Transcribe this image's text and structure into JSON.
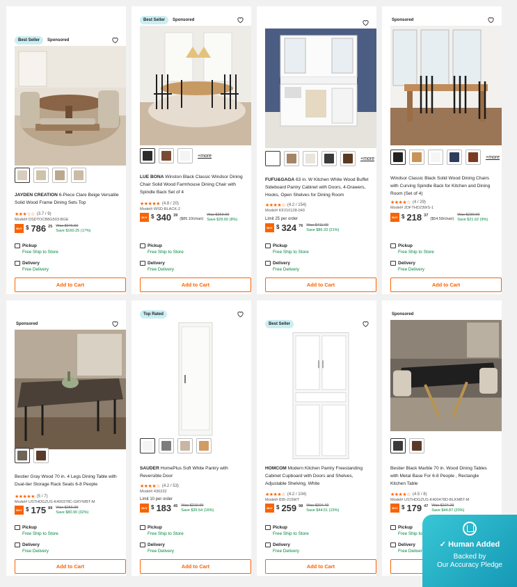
{
  "products": [
    {
      "badges": [
        "Best Seller",
        "Sponsored"
      ],
      "brand": "JAYDEN CREATION",
      "title": "6-Piece Clare Beige Versatile Solid Wood Frame Dining Sets Top",
      "stars": "★★★☆☆",
      "rating": "(3.7 / 9)",
      "model": "Model# DSDTOCB8G503-BGE",
      "limit": "",
      "price_dollars": "786",
      "price_cents": "25",
      "price_unit": "",
      "was": "Was $946.50",
      "save": "Save $160.25 (17%)",
      "swatch_colors": [
        "#d8cdbd",
        "#cfc2ab",
        "#bca88c",
        "#c9bba5"
      ],
      "more": "",
      "pickup": "Pickup",
      "pickup_sub": "Free Ship to Store",
      "delivery": "Delivery",
      "delivery_sub": "Free Delivery",
      "cta": "Add to Cart"
    },
    {
      "badges": [
        "Best Seller",
        "Sponsored"
      ],
      "brand": "LUE BONA",
      "title": "Winston Black Classic Windsor Dining Chair Solid Wood Farmhouse Dining Chair with Spindle Back Set of 4",
      "stars": "★★★★★",
      "rating": "(4.8 / 20)",
      "model": "Model# WSD-BLACK-2",
      "limit": "",
      "price_dollars": "340",
      "price_cents": "39",
      "price_unit": "($85.10/chair)",
      "was": "Was $369.99",
      "save": "Save $29.60 (8%)",
      "swatch_colors": [
        "#2b2b2b",
        "#7a4b32",
        "#f4f4f4"
      ],
      "more": "+more",
      "pickup": "Pickup",
      "pickup_sub": "Free Ship to Store",
      "delivery": "Delivery",
      "delivery_sub": "Free Delivery",
      "cta": "Add to Cart"
    },
    {
      "badges": [],
      "brand": "FUFU&GAGA",
      "title": "63 in. W Kitchen White Wood Buffet Sideboard Pantry Cabinet with Doors, 4-Drawers, Hooks, Open Shelves for Dining Room",
      "stars": "★★★★☆",
      "rating": "(4.2 / 154)",
      "model": "Model# KF210128-043",
      "limit": "Limit 25 per order",
      "price_dollars": "324",
      "price_cents": "76",
      "price_unit": "",
      "was": "Was $411.09",
      "save": "Save $86.33 (21%)",
      "swatch_colors": [
        "#ffffff",
        "#a68466",
        "#e9e4dc",
        "#3a3a3a",
        "#5a3b22"
      ],
      "more": "+more",
      "pickup": "Pickup",
      "pickup_sub": "Free Ship to Store",
      "delivery": "Delivery",
      "delivery_sub": "Free Delivery",
      "cta": "Add to Cart"
    },
    {
      "badges": [
        "Sponsored"
      ],
      "brand": "",
      "title": "Windsor Classic Black Solid Wood Dining Chairs with Curving Spindle Back for Kitchen and Dining Room (Set of 4)",
      "stars": "★★★★☆",
      "rating": "(4 / 29)",
      "model": "Model# 2DFTHD23WS-1",
      "limit": "",
      "price_dollars": "218",
      "price_cents": "37",
      "price_unit": "($54.59/chair)",
      "was": "Was $239.99",
      "save": "Save $21.62 (9%)",
      "swatch_colors": [
        "#222222",
        "#c89457",
        "#f6f6f6",
        "#2e3d5c",
        "#7b3a22"
      ],
      "more": "+more",
      "pickup": "Pickup",
      "pickup_sub": "Free Ship to Store",
      "delivery": "Delivery",
      "delivery_sub": "Free Delivery",
      "cta": "Add to Cart"
    },
    {
      "badges": [
        "Sponsored"
      ],
      "brand": "",
      "title": "Bestier Gray Wood 70 in. 4 Legs Dining Table with Dual-tier Storage Rack Seats 6-8 People",
      "stars": "★★★★★",
      "rating": "(5 / 7)",
      "model": "Model# USTHDGZUS-K400378C-GRYWBT-M",
      "limit": "",
      "price_dollars": "175",
      "price_cents": "89",
      "price_unit": "",
      "was": "Was $256.99",
      "save": "Save $80.90 (32%)",
      "swatch_colors": [
        "#6e6458",
        "#5a3a2a"
      ],
      "more": "",
      "pickup": "Pickup",
      "pickup_sub": "Free Ship to Store",
      "delivery": "Delivery",
      "delivery_sub": "Free Delivery",
      "cta": "Add to Cart"
    },
    {
      "badges": [
        "Top Rated"
      ],
      "brand": "SAUDER",
      "title": "HomePlus Soft White Pantry with Reversible Door",
      "stars": "★★★★☆",
      "rating": "(4.2 / 53)",
      "model": "Model# 430232",
      "limit": "Limit 10 per order",
      "price_dollars": "183",
      "price_cents": "45",
      "price_unit": "",
      "was": "Was $219.99",
      "save": "Save $35.54 (16%)",
      "swatch_colors": [
        "#f5f5f5",
        "#7d7d7d",
        "#c9b6a2",
        "#d19b62"
      ],
      "more": "",
      "pickup": "Pickup",
      "pickup_sub": "Free Ship to Store",
      "delivery": "Delivery",
      "delivery_sub": "Free Delivery",
      "cta": "Add to Cart"
    },
    {
      "badges": [
        "Best Seller"
      ],
      "brand": "HOMCOM",
      "title": "Modern Kitchen Pantry Freestanding Cabinet Cupboard with Doors and Shelves, Adjustable Shelving, White",
      "stars": "★★★★☆",
      "rating": "(4.2 / 104)",
      "model": "Model# 835-215WT",
      "limit": "",
      "price_dollars": "259",
      "price_cents": "98",
      "price_unit": "",
      "was": "Was $304.49",
      "save": "Save $44.51 (15%)",
      "swatch_colors": [],
      "more": "",
      "pickup": "Pickup",
      "pickup_sub": "Free Ship to Store",
      "delivery": "Delivery",
      "delivery_sub": "Free Delivery",
      "cta": "Add to Cart"
    },
    {
      "badges": [
        "Sponsored"
      ],
      "brand": "",
      "title": "Bestier Black Marble 70 in. Wood Dining Tables with Metal Base For 6-8 People , Rectangle Kitchen Table",
      "stars": "★★★★☆",
      "rating": "(4.5 / 8)",
      "model": "Model# USTHDGZUS-K400478D-BLKMBT-M",
      "limit": "",
      "price_dollars": "179",
      "price_cents": "47",
      "price_unit": "",
      "was": "Was $224.29",
      "save": "Save $44.87 (20%)",
      "swatch_colors": [
        "#3a3a3a",
        "#5b3b28"
      ],
      "more": "",
      "pickup": "Pickup",
      "pickup_sub": "Free Ship to Store",
      "delivery": "Delivery",
      "delivery_sub": "Free Delivery",
      "cta": "Add to Cart"
    }
  ],
  "buy_label": "BUY",
  "overlay": {
    "line1": "Human Added",
    "line2": "Backed by",
    "line3": "Our Accuracy Pledge"
  }
}
